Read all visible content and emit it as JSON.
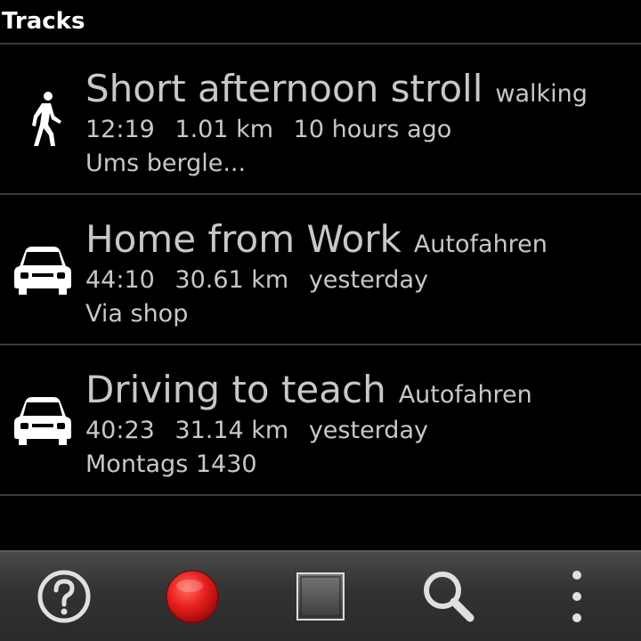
{
  "header": {
    "title": "Tracks"
  },
  "tracks": [
    {
      "name": "Short afternoon stroll",
      "category": "walking",
      "duration": "12:19",
      "distance": "1.01 km",
      "when": "10 hours ago",
      "description": "Ums bergle...",
      "icon": "walking-icon"
    },
    {
      "name": "Home from Work",
      "category": "Autofahren",
      "duration": "44:10",
      "distance": "30.61 km",
      "when": "yesterday",
      "description": "Via shop",
      "icon": "car-icon"
    },
    {
      "name": "Driving to teach",
      "category": "Autofahren",
      "duration": "40:23",
      "distance": "31.14 km",
      "when": "yesterday",
      "description": "Montags 1430",
      "icon": "car-icon"
    }
  ],
  "bottom_bar": {
    "buttons": [
      {
        "icon": "help-icon"
      },
      {
        "icon": "record-icon",
        "color": "#e8201f"
      },
      {
        "icon": "stop-icon"
      },
      {
        "icon": "search-icon"
      },
      {
        "icon": "overflow-menu-icon"
      }
    ]
  },
  "colors": {
    "background": "#000000",
    "text_primary": "#c8c8c8",
    "title_text": "#ffffff",
    "divider": "#3a3a3a",
    "record": "#e8201f"
  }
}
